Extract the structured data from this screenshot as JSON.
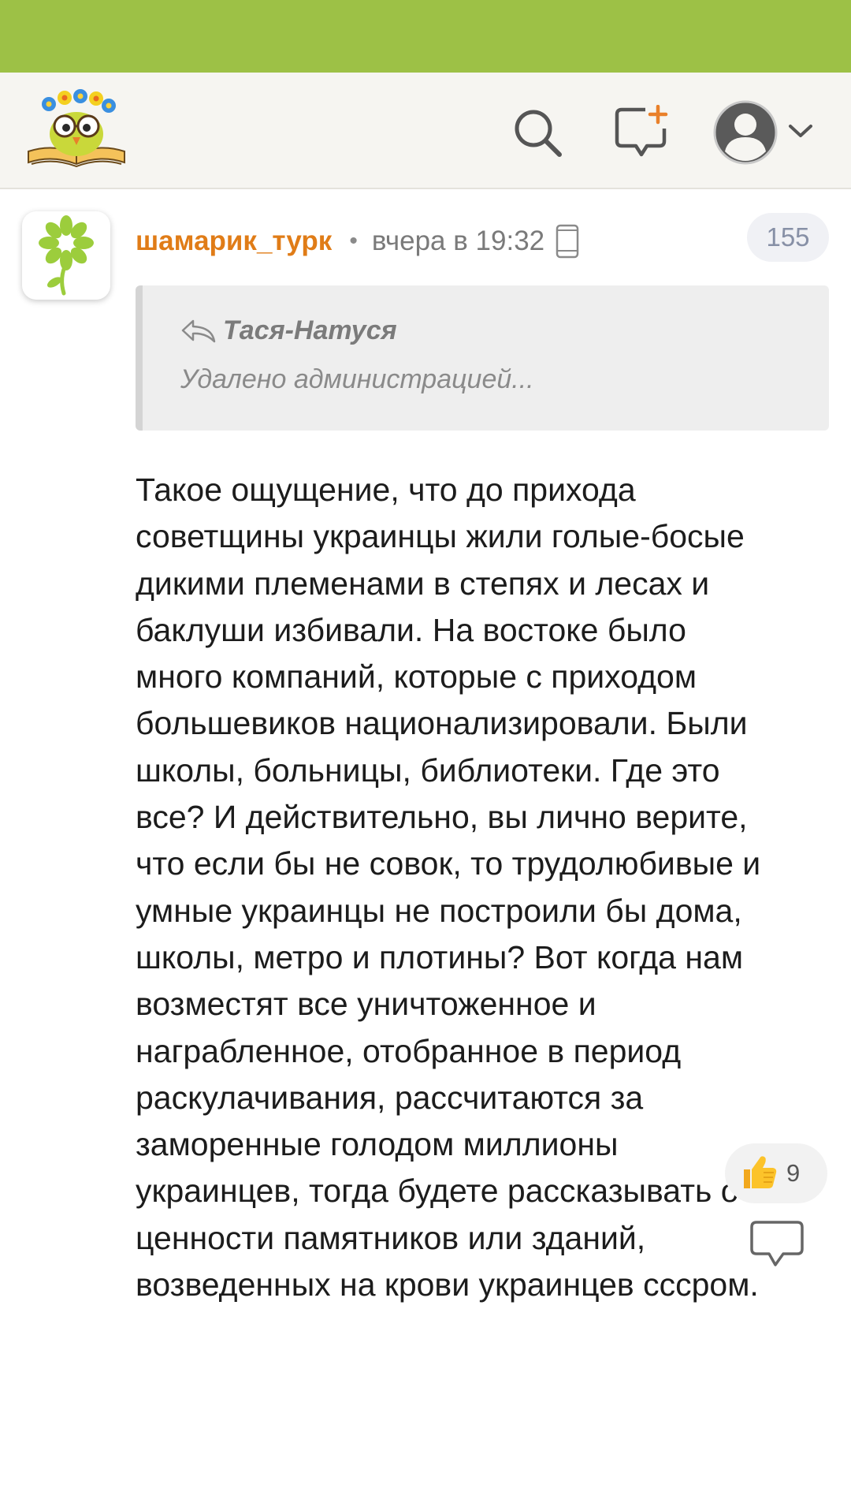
{
  "header": {
    "logo_icon": "owl-on-book-logo",
    "search_icon": "search-icon",
    "new_message_icon": "new-message-icon",
    "profile_icon": "user-avatar-icon",
    "menu_icon": "chevron-down-icon"
  },
  "comment": {
    "author": "шамарик_турк",
    "separator": "•",
    "time": "вчера в 19:32",
    "device_icon": "phone-icon",
    "comment_count": "155",
    "quote": {
      "author": "Тася-Натуся",
      "text": "Удалено администрацией..."
    },
    "body_lines": [
      "Такое ощущение, что до прихода",
      "советщины украинцы жили голые-босые",
      "дикими племенами в степях и лесах и",
      "баклуши избивали. На востоке было",
      "много компаний, которые с приходом",
      "большевиков национализировали. Были",
      "школы, больницы, библиотеки. Где это",
      "все? И действительно, вы лично верите,",
      "что если бы не совок, то трудолюбивые и",
      "умные украинцы не построили бы дома,",
      "школы, метро и плотины? Вот когда нам",
      "возместят все уничтоженное и",
      "награбленное, отобранное в период",
      "раскулачивания, рассчитаются за",
      "заморенные голодом миллионы",
      "украинцев, тогда будете рассказывать о",
      "ценности памятников или зданий,",
      "возведенных на крови украинцев сссром."
    ],
    "likes": "9",
    "like_icon": "thumbs-up-icon",
    "reply_icon": "speech-bubble-icon"
  },
  "colors": {
    "status_bar": "#9dc146",
    "header_bg": "#f6f5f1",
    "username": "#e07c17",
    "badge_text": "#8790a6"
  }
}
